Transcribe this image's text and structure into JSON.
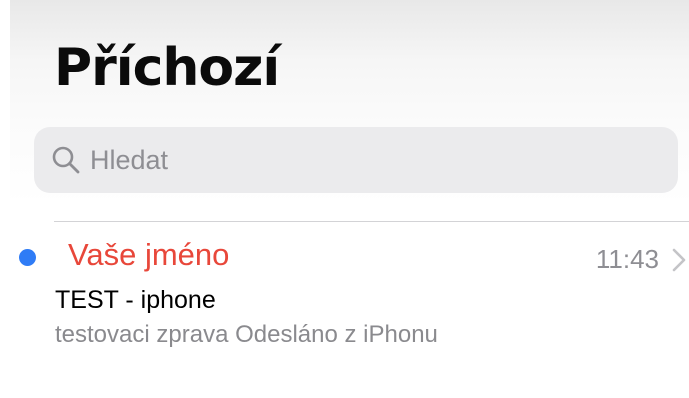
{
  "header": {
    "title": "Příchozí"
  },
  "search": {
    "placeholder": "Hledat",
    "icon": "magnifying-glass"
  },
  "messages": [
    {
      "unread": true,
      "sender": "Vaše jméno",
      "time": "11:43",
      "subject": "TEST - iphone",
      "preview": "testovaci zprava Odesláno z iPhonu"
    }
  ],
  "colors": {
    "accent": "#2f7cf6",
    "sender": "#e8473a",
    "secondary_text": "#8e8e93",
    "search_bg": "#ebebed"
  }
}
